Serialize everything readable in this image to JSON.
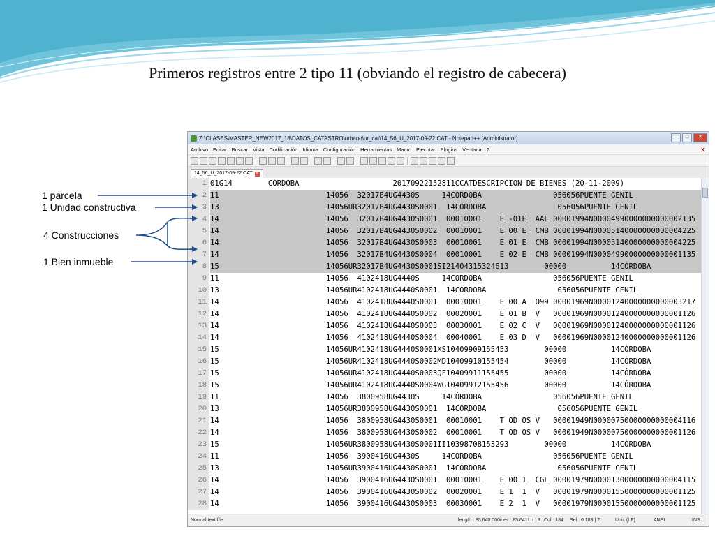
{
  "slide": {
    "title": "Primeros registros entre 2 tipo 11 (obviando el registro de cabecera)"
  },
  "annotations": [
    {
      "label": "1 parcela"
    },
    {
      "label": "1 Unidad constructiva"
    },
    {
      "label": "4 Construcciones"
    },
    {
      "label": "1 Bien inmueble"
    }
  ],
  "window": {
    "title": "Z:\\CLASES\\MASTER_NEW2017_18\\DATOS_CATASTRO\\urbano\\ur_cat\\14_56_U_2017-09-22.CAT - Notepad++ [Administrator]",
    "close_x": "X",
    "menu": [
      "Archivo",
      "Editar",
      "Buscar",
      "Vista",
      "Codificación",
      "Idioma",
      "Configuración",
      "Herramientas",
      "Macro",
      "Ejecutar",
      "Plugins",
      "Ventana",
      "?"
    ],
    "tab": {
      "label": "14_56_U_2017-09-22.CAT",
      "close": "x"
    },
    "icons": {
      "app": "notepad-plus-icon",
      "minimize": "minimize-icon",
      "maximize": "maximize-icon",
      "close": "close-icon"
    }
  },
  "editor": {
    "lines": [
      {
        "n": "1",
        "t": "01G14        CÓRDOBA                     20170922152811CCATDESCRIPCION DE BIENES (20-11-2009)"
      },
      {
        "n": "2",
        "t": "11                        14056  32017B4UG4430S     14CÓRDOBA                056056PUENTE GENIL"
      },
      {
        "n": "3",
        "t": "13                        14056UR32017B4UG4430S0001  14CÓRDOBA                056056PUENTE GENIL"
      },
      {
        "n": "4",
        "t": "14                        14056  32017B4UG4430S0001  00010001    E -01E  AAL 00001994N00004990000000000002135"
      },
      {
        "n": "5",
        "t": "14                        14056  32017B4UG4430S0002  00010001    E 00 E  CMB 00001994N00005140000000000004225"
      },
      {
        "n": "6",
        "t": "14                        14056  32017B4UG4430S0003  00010001    E 01 E  CMB 00001994N00005140000000000004225"
      },
      {
        "n": "7",
        "t": "14                        14056  32017B4UG4430S0004  00010001    E 02 E  CMB 00001994N00004990000000000001135"
      },
      {
        "n": "8",
        "t": "15                        14056UR32017B4UG4430S0001SI21404315324613        00000          14CÓRDOBA"
      },
      {
        "n": "9",
        "t": "11                        14056  4102418UG4440S     14CÓRDOBA                056056PUENTE GENIL"
      },
      {
        "n": "10",
        "t": "13                        14056UR4102418UG4440S0001  14CÓRDOBA                056056PUENTE GENIL"
      },
      {
        "n": "11",
        "t": "14                        14056  4102418UG4440S0001  00010001    E 00 A  O99 00001969N00001240000000000003217"
      },
      {
        "n": "12",
        "t": "14                        14056  4102418UG4440S0002  00020001    E 01 B  V   00001969N00001240000000000001126"
      },
      {
        "n": "13",
        "t": "14                        14056  4102418UG4440S0003  00030001    E 02 C  V   00001969N00001240000000000001126"
      },
      {
        "n": "14",
        "t": "14                        14056  4102418UG4440S0004  00040001    E 03 D  V   00001969N00001240000000000001126"
      },
      {
        "n": "15",
        "t": "15                        14056UR4102418UG4440S0001XS10409909155453        00000          14CÓRDOBA"
      },
      {
        "n": "16",
        "t": "15                        14056UR4102418UG4440S0002MD10409910155454        00000          14CÓRDOBA"
      },
      {
        "n": "17",
        "t": "15                        14056UR4102418UG4440S0003QF10409911155455        00000          14CÓRDOBA"
      },
      {
        "n": "18",
        "t": "15                        14056UR4102418UG4440S0004WG10409912155456        00000          14CÓRDOBA"
      },
      {
        "n": "19",
        "t": "11                        14056  3800958UG4430S     14CÓRDOBA                056056PUENTE GENIL"
      },
      {
        "n": "20",
        "t": "13                        14056UR3800958UG4430S0001  14CÓRDOBA                056056PUENTE GENIL"
      },
      {
        "n": "21",
        "t": "14                        14056  3800958UG4430S0001  00010001    T OD OS V   00001949N00000750000000000004116"
      },
      {
        "n": "22",
        "t": "14                        14056  3800958UG4430S0002  00010001    T OD OS V   00001949N00000750000000000001126"
      },
      {
        "n": "23",
        "t": "15                        14056UR3800958UG4430S0001II10398708153293        00000          14CÓRDOBA"
      },
      {
        "n": "24",
        "t": "11                        14056  3900416UG4430S     14CÓRDOBA                056056PUENTE GENIL"
      },
      {
        "n": "25",
        "t": "13                        14056UR3900416UG4430S0001  14CÓRDOBA                056056PUENTE GENIL"
      },
      {
        "n": "26",
        "t": "14                        14056  3900416UG4430S0001  00010001    E 00 1  CGL 00001979N00001300000000000004115"
      },
      {
        "n": "27",
        "t": "14                        14056  3900416UG4430S0002  00020001    E 1  1  V   00001979N00001550000000000001125"
      },
      {
        "n": "28",
        "t": "14                        14056  3900416UG4430S0003  00030001    E 2  1  V   00001979N00001550000000000001125"
      }
    ]
  },
  "status": {
    "type": "Normal text file",
    "length": "length : 85.640.000",
    "lines": "lines : 85.641",
    "ln": "Ln : 8",
    "col": "Col : 184",
    "sel": "Sel : 6.183 | 7",
    "eol": "Unix (LF)",
    "encoding": "ANSI",
    "mode": "INS"
  },
  "colors": {
    "selection": "#c7c7c7",
    "arrow": "#1f4e8c",
    "deco_wave": "#4fb3cf"
  }
}
